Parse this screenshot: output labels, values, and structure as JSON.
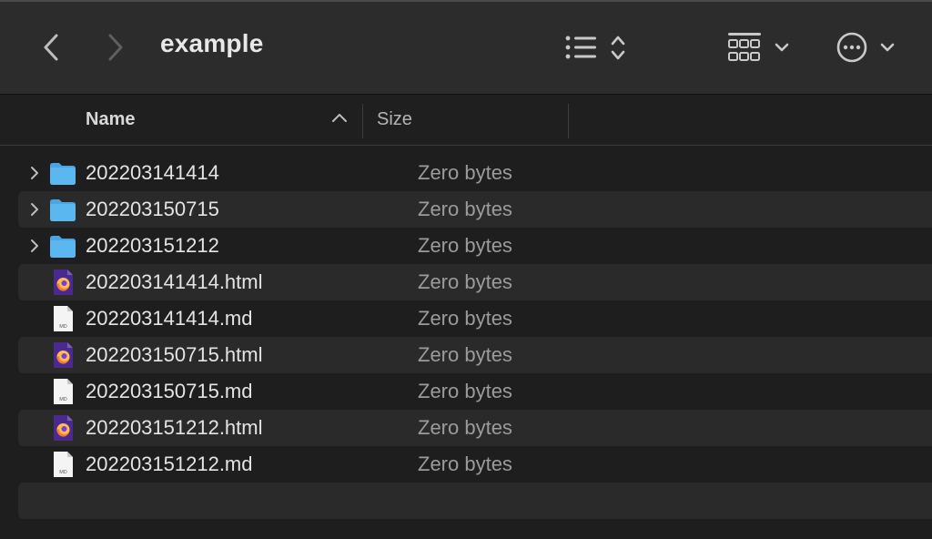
{
  "window": {
    "title": "example"
  },
  "toolbar": {
    "back_icon": "chevron-left-icon",
    "forward_icon": "chevron-right-icon",
    "view_icon": "list-view-icon",
    "group_icon": "grid-group-icon",
    "more_icon": "ellipsis-circle-icon"
  },
  "columns": {
    "name": "Name",
    "size": "Size"
  },
  "files": [
    {
      "name": "202203141414",
      "size": "Zero bytes",
      "kind": "folder"
    },
    {
      "name": "202203150715",
      "size": "Zero bytes",
      "kind": "folder"
    },
    {
      "name": "202203151212",
      "size": "Zero bytes",
      "kind": "folder"
    },
    {
      "name": "202203141414.html",
      "size": "Zero bytes",
      "kind": "html"
    },
    {
      "name": "202203141414.md",
      "size": "Zero bytes",
      "kind": "md"
    },
    {
      "name": "202203150715.html",
      "size": "Zero bytes",
      "kind": "html"
    },
    {
      "name": "202203150715.md",
      "size": "Zero bytes",
      "kind": "md"
    },
    {
      "name": "202203151212.html",
      "size": "Zero bytes",
      "kind": "html"
    },
    {
      "name": "202203151212.md",
      "size": "Zero bytes",
      "kind": "md"
    }
  ],
  "icon_labels": {
    "md_badge": "MD"
  },
  "colors": {
    "folder": "#5bb7f0",
    "html_icon_bg": "#4b2a8f",
    "accent": "#ff7139"
  }
}
